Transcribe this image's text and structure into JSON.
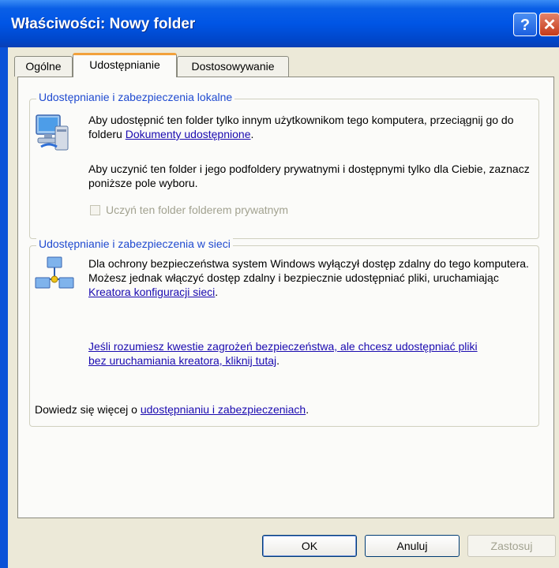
{
  "window": {
    "title": "Właściwości: Nowy folder",
    "help_label": "?",
    "close_label": "✕"
  },
  "tabs": [
    {
      "label": "Ogólne"
    },
    {
      "label": "Udostępnianie"
    },
    {
      "label": "Dostosowywanie"
    }
  ],
  "local": {
    "legend": "Udostępnianie i zabezpieczenia lokalne",
    "para1_text": "Aby udostępnić ten folder tylko innym użytkownikom tego komputera, przeciągnij go do folderu ",
    "para1_link": "Dokumenty udostępnione",
    "para1_end": ".",
    "para2_text": "Aby uczynić ten folder i jego podfoldery prywatnymi i dostępnymi tylko dla Ciebie, zaznacz poniższe pole wyboru.",
    "checkbox_label": "Uczyń ten folder folderem prywatnym",
    "checkbox_checked": false
  },
  "network": {
    "legend": "Udostępnianie i zabezpieczenia w sieci",
    "para1_text": "Dla ochrony bezpieczeństwa system Windows wyłączył dostęp zdalny do tego komputera. Możesz jednak włączyć dostęp zdalny i bezpiecznie udostępniać pliki, uruchamiając ",
    "para1_link": "Kreatora konfiguracji sieci",
    "para1_end": ".",
    "risk_link": "Jeśli rozumiesz kwestie zagrożeń bezpieczeństwa, ale chcesz udostępniać pliki bez uruchamiania kreatora, kliknij tutaj",
    "risk_end": ".",
    "learn_text": "Dowiedz się więcej o ",
    "learn_link": "udostępnianiu i zabezpieczeniach",
    "learn_end": "."
  },
  "buttons": {
    "ok": "OK",
    "cancel": "Anuluj",
    "apply": "Zastosuj"
  },
  "icons": {
    "local": "computer-share-icon",
    "network": "network-computers-icon"
  }
}
